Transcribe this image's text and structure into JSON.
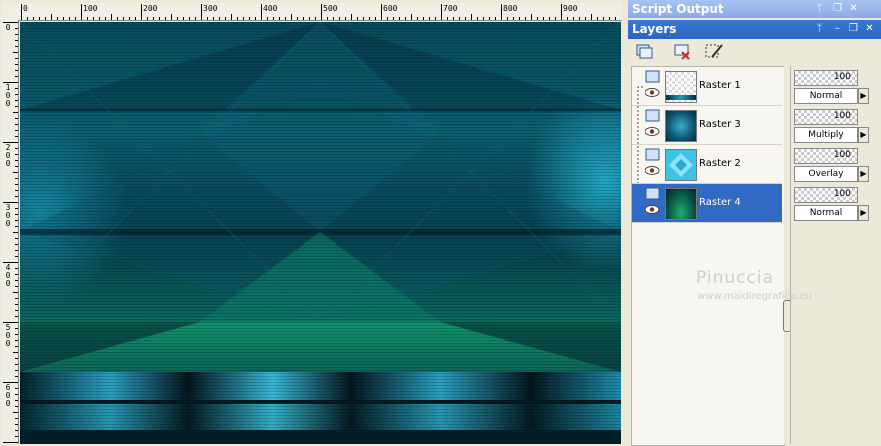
{
  "ruler": {
    "h_labels": [
      "0",
      "100",
      "200",
      "300",
      "400",
      "500",
      "600",
      "700",
      "800",
      "900"
    ],
    "v_labels": [
      "0",
      "100",
      "200",
      "300",
      "400",
      "500",
      "600"
    ]
  },
  "panels": {
    "script_output": {
      "title": "Script Output"
    },
    "layers": {
      "title": "Layers"
    }
  },
  "layers": [
    {
      "name": "Raster 1",
      "opacity": "100",
      "blend": "Normal"
    },
    {
      "name": "Raster 3",
      "opacity": "100",
      "blend": "Multiply"
    },
    {
      "name": "Raster 2",
      "opacity": "100",
      "blend": "Overlay"
    },
    {
      "name": "Raster 4",
      "opacity": "100",
      "blend": "Normal"
    }
  ],
  "watermark": {
    "name": "Pinuccia",
    "url": "www.maidiregrafica.eu"
  },
  "colors": {
    "teal_dark": "#02323d",
    "teal": "#0f6f7c",
    "green": "#129a6a",
    "cyan": "#27b6d6",
    "selection": "#316ac5"
  }
}
